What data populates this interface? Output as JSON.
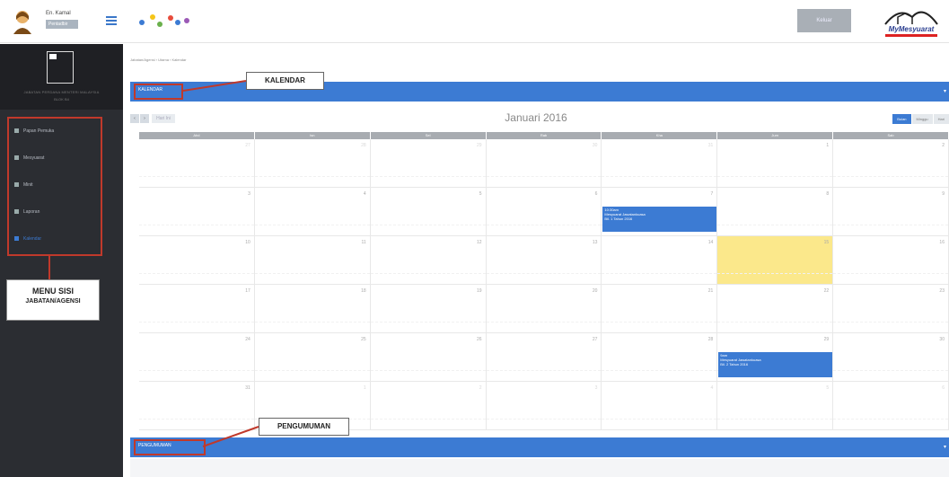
{
  "header": {
    "user_name": "En. Kamal",
    "user_role": "Pentadbir",
    "button_label": "Keluar",
    "logo_text": "MyMesyuarat"
  },
  "sidebar": {
    "title": "JABATAN PERDANA MENTERI MALAYSIA",
    "subtitle": "BLOK B4",
    "items": [
      {
        "label": "Papan Pemuka",
        "active": false
      },
      {
        "label": "Mesyuarat",
        "active": false
      },
      {
        "label": "Minit",
        "active": false
      },
      {
        "label": "Laporan",
        "active": false
      },
      {
        "label": "Kalendar",
        "active": true
      }
    ],
    "annotation": {
      "line1": "MENU SISI",
      "line2": "JABATAN/AGENSI"
    }
  },
  "main": {
    "breadcrumb": "Jabatan/Agensi  ›  Utama  ›  Kalendar",
    "kalendar_bar": "KALENDAR",
    "kalendar_callout": "KALENDAR",
    "pengumuman_bar": "PENGUMUMAN",
    "pengumuman_callout": "PENGUMUMAN"
  },
  "calendar": {
    "title": "Januari 2016",
    "prev": "‹",
    "next": "›",
    "today": "Hari Ini",
    "views": [
      "Bulan",
      "Minggu",
      "Hari"
    ],
    "day_names": [
      "Ahd",
      "Isn",
      "Sel",
      "Rab",
      "Kha",
      "Jum",
      "Sab"
    ],
    "weeks": [
      [
        {
          "d": "27",
          "o": true
        },
        {
          "d": "28",
          "o": true
        },
        {
          "d": "29",
          "o": true
        },
        {
          "d": "30",
          "o": true
        },
        {
          "d": "31",
          "o": true
        },
        {
          "d": "1",
          "o": false
        },
        {
          "d": "2",
          "o": false
        }
      ],
      [
        {
          "d": "3",
          "o": false
        },
        {
          "d": "4",
          "o": false
        },
        {
          "d": "5",
          "o": false
        },
        {
          "d": "6",
          "o": false
        },
        {
          "d": "7",
          "o": false
        },
        {
          "d": "8",
          "o": false
        },
        {
          "d": "9",
          "o": false
        }
      ],
      [
        {
          "d": "10",
          "o": false
        },
        {
          "d": "11",
          "o": false
        },
        {
          "d": "12",
          "o": false
        },
        {
          "d": "13",
          "o": false
        },
        {
          "d": "14",
          "o": false
        },
        {
          "d": "15",
          "o": false,
          "today": true
        },
        {
          "d": "16",
          "o": false
        }
      ],
      [
        {
          "d": "17",
          "o": false
        },
        {
          "d": "18",
          "o": false
        },
        {
          "d": "19",
          "o": false
        },
        {
          "d": "20",
          "o": false
        },
        {
          "d": "21",
          "o": false
        },
        {
          "d": "22",
          "o": false
        },
        {
          "d": "23",
          "o": false
        }
      ],
      [
        {
          "d": "24",
          "o": false
        },
        {
          "d": "25",
          "o": false
        },
        {
          "d": "26",
          "o": false
        },
        {
          "d": "27",
          "o": false
        },
        {
          "d": "28",
          "o": false
        },
        {
          "d": "29",
          "o": false
        },
        {
          "d": "30",
          "o": false
        }
      ],
      [
        {
          "d": "31",
          "o": false
        },
        {
          "d": "1",
          "o": true
        },
        {
          "d": "2",
          "o": true
        },
        {
          "d": "3",
          "o": true
        },
        {
          "d": "4",
          "o": true
        },
        {
          "d": "5",
          "o": true
        },
        {
          "d": "6",
          "o": true
        }
      ]
    ],
    "events": [
      {
        "week": 1,
        "day": 4,
        "lines": [
          "10:30am",
          "Mesyuarat Jawatankuasa",
          "Bil. 1 Tahun 2016"
        ]
      },
      {
        "week": 4,
        "day": 5,
        "lines": [
          "9am",
          "Mesyuarat Jawatankuasa",
          "Bil. 2 Tahun 2016"
        ]
      }
    ]
  },
  "colors": {
    "accent": "#3c7bd3",
    "sidebar": "#2b2d32",
    "annotation": "#c0392b",
    "today": "#fbe88b"
  }
}
